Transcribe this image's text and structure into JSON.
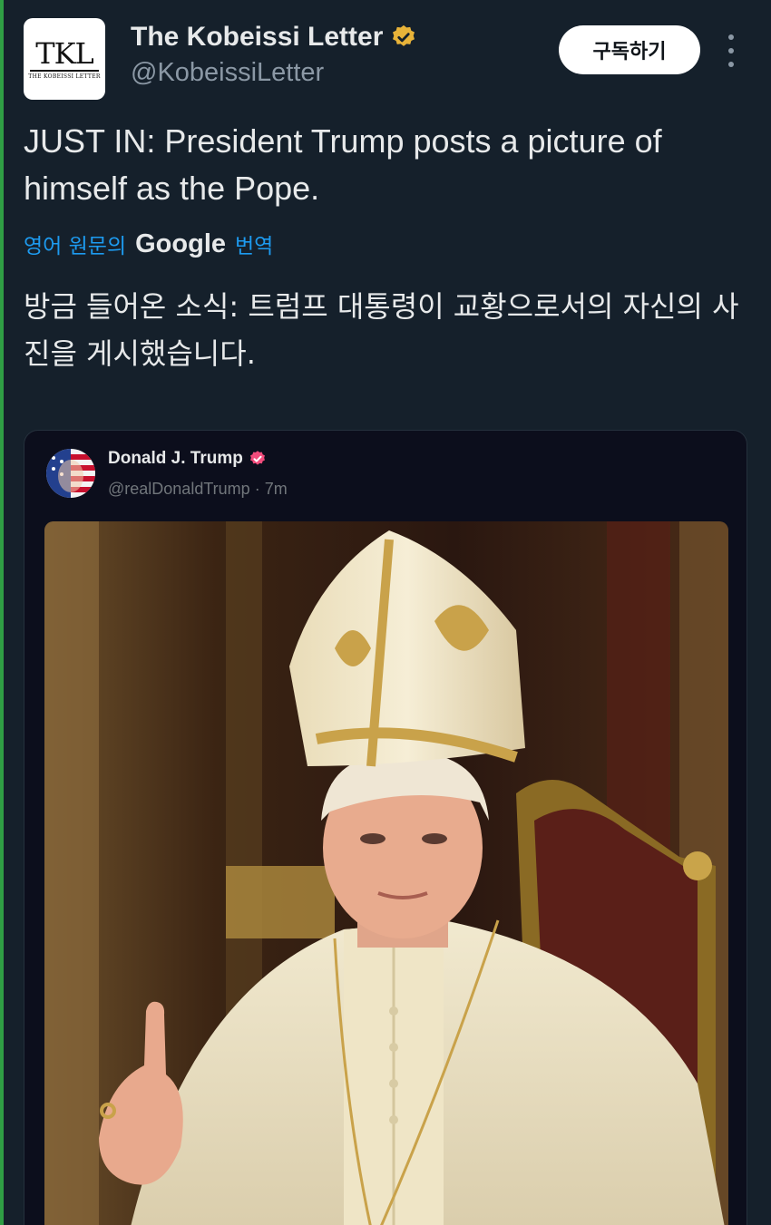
{
  "author": {
    "display_name": "The Kobeissi Letter",
    "handle": "@KobeissiLetter",
    "avatar_mark": "TKL",
    "avatar_subtext": "THE KOBEISSI LETTER",
    "verified_badge_icon": "verified-gold-badge-icon"
  },
  "actions": {
    "subscribe_label": "구독하기",
    "more_icon": "vertical-ellipsis-icon"
  },
  "tweet": {
    "text": "JUST IN: President Trump posts a picture of himself as the Pope.",
    "translate_prefix": "영어 원문의",
    "translate_brand": "Google",
    "translate_suffix": "번역",
    "translated_text": "방금 들어온 소식: 트럼프 대통령이 교황으로서의 자신의 사진을 게시했습니다."
  },
  "quoted_post": {
    "display_name": "Donald J. Trump",
    "handle": "@realDonaldTrump",
    "separator": "·",
    "time": "7m",
    "badge_icon": "verified-pink-badge-icon",
    "image_description_icon": "pope-portrait-image"
  },
  "colors": {
    "background": "#15202b",
    "link": "#1d9bf0",
    "accent_strip": "#2f9e44",
    "gold_badge": "#e8b339",
    "pink_badge": "#f24c7c"
  }
}
